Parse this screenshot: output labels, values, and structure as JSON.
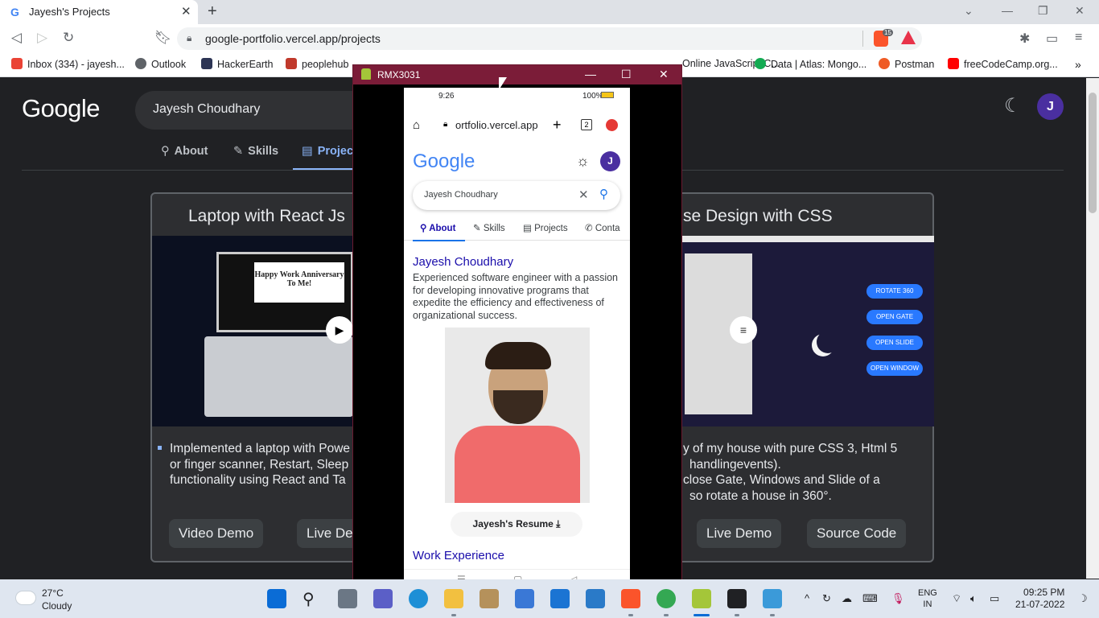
{
  "browser": {
    "tab_title": "Jayesh's Projects",
    "url": "google-portfolio.vercel.app/projects",
    "brave_badge": "15",
    "bookmarks": [
      {
        "label": "Inbox (334) - jayesh...",
        "color": "#ea4335"
      },
      {
        "label": "Outlook",
        "color": "#5f6368"
      },
      {
        "label": "HackerEarth",
        "color": "#2c3454"
      },
      {
        "label": "peoplehub",
        "color": "#c0392b"
      },
      {
        "label": "Data | Atlas: Mongo...",
        "color": "#13aa52"
      },
      {
        "label": "Postman",
        "color": "#ef5b25"
      },
      {
        "label": "freeCodeCamp.org...",
        "color": "#ff0000"
      }
    ],
    "bookmarks_partial": [
      "Online JavaScript C..."
    ]
  },
  "page": {
    "logo": "Google",
    "search_value": "Jayesh Choudhary",
    "avatar_letter": "J",
    "tabs": [
      {
        "label": "About",
        "icon": "search-icon"
      },
      {
        "label": "Skills",
        "icon": "pencil-icon"
      },
      {
        "label": "Projec",
        "icon": "chart-icon"
      }
    ],
    "card_left": {
      "title": "Laptop with React Js",
      "screen_text": "Happy Work Anniversary To Me!",
      "desc": [
        "Implemented a laptop with Powe",
        "or finger scanner, Restart, Sleep",
        "functionality using React and Ta"
      ],
      "buttons": [
        "Video Demo",
        "Live De"
      ]
    },
    "card_right": {
      "title": "se Design with CSS",
      "controls": [
        "ROTATE 360",
        "OPEN GATE",
        "OPEN SLIDE",
        "OPEN WINDOW"
      ],
      "desc": [
        "y of my house with pure CSS 3, Html 5",
        "handlingevents).",
        "close Gate, Windows and Slide of a",
        "so rotate a house in 360°."
      ],
      "buttons": [
        "Live Demo",
        "Source Code"
      ]
    }
  },
  "scrcpy": {
    "title": "RMX3031",
    "phone": {
      "time": "9:26",
      "battery": "100%",
      "url": "ortfolio.vercel.app",
      "tab_count": "2",
      "logo": "Google",
      "avatar_letter": "J",
      "search_value": "Jayesh Choudhary",
      "tabs": [
        "About",
        "Skills",
        "Projects",
        "Conta"
      ],
      "name": "Jayesh Choudhary",
      "description": "Experienced software engineer with a passion for developing innovative programs that expedite the efficiency and effectiveness of organizational success.",
      "resume_button": "Jayesh's Resume",
      "section_heading": "Work Experience"
    }
  },
  "taskbar": {
    "temperature": "27°C",
    "condition": "Cloudy",
    "lang_top": "ENG",
    "lang_bottom": "IN",
    "time": "09:25 PM",
    "date": "21-07-2022"
  },
  "colors": {
    "page_bg": "#202124",
    "accent": "#8ab4f8",
    "scrcpy_title": "#7b1c38",
    "phone_link": "#1a0dab"
  }
}
